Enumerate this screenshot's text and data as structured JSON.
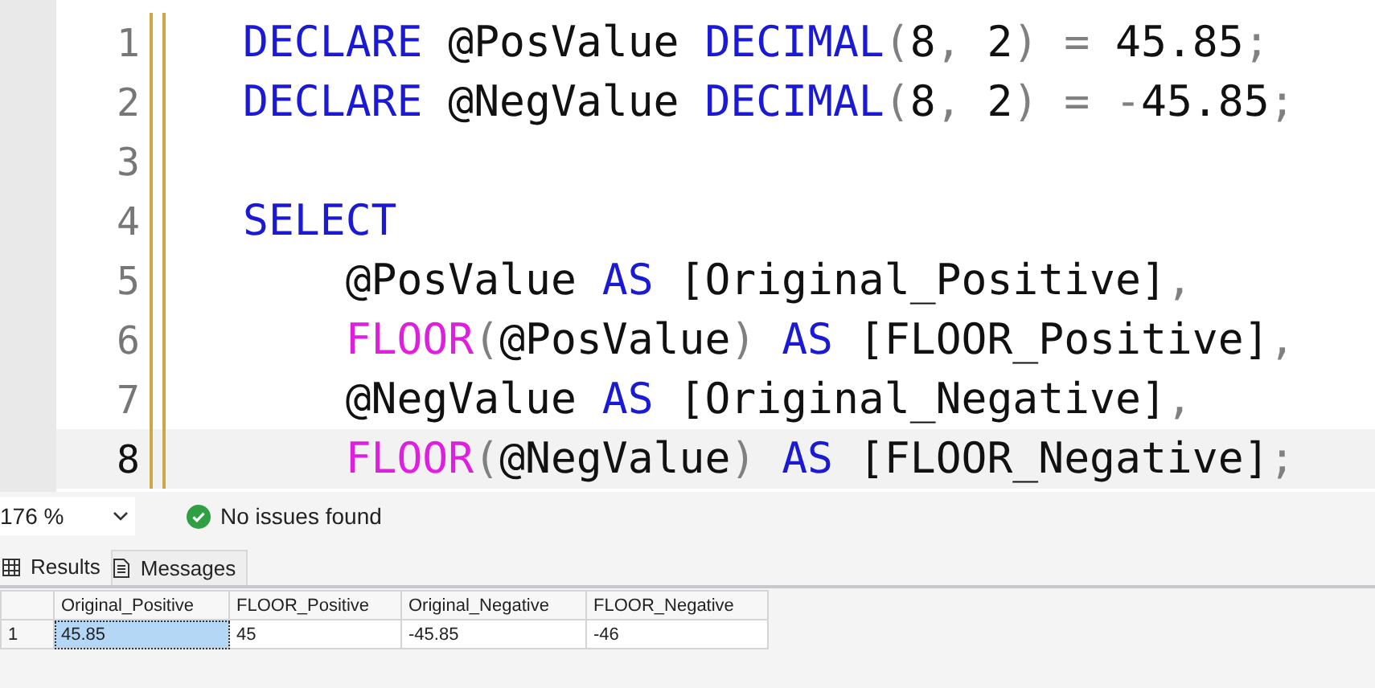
{
  "editor": {
    "lines": [
      {
        "number": "1",
        "current": false,
        "indent": false,
        "tokens": [
          {
            "kind": "keyword",
            "text": "DECLARE"
          },
          {
            "kind": "plain",
            "text": " @PosValue "
          },
          {
            "kind": "keyword",
            "text": "DECIMAL"
          },
          {
            "kind": "operator",
            "text": "("
          },
          {
            "kind": "plain",
            "text": "8"
          },
          {
            "kind": "operator",
            "text": ", "
          },
          {
            "kind": "plain",
            "text": "2"
          },
          {
            "kind": "operator",
            "text": ")"
          },
          {
            "kind": "operator",
            "text": " = "
          },
          {
            "kind": "plain",
            "text": "45.85"
          },
          {
            "kind": "operator",
            "text": ";"
          }
        ]
      },
      {
        "number": "2",
        "current": false,
        "indent": false,
        "tokens": [
          {
            "kind": "keyword",
            "text": "DECLARE"
          },
          {
            "kind": "plain",
            "text": " @NegValue "
          },
          {
            "kind": "keyword",
            "text": "DECIMAL"
          },
          {
            "kind": "operator",
            "text": "("
          },
          {
            "kind": "plain",
            "text": "8"
          },
          {
            "kind": "operator",
            "text": ", "
          },
          {
            "kind": "plain",
            "text": "2"
          },
          {
            "kind": "operator",
            "text": ")"
          },
          {
            "kind": "operator",
            "text": " = -"
          },
          {
            "kind": "plain",
            "text": "45.85"
          },
          {
            "kind": "operator",
            "text": ";"
          }
        ]
      },
      {
        "number": "3",
        "current": false,
        "indent": false
      },
      {
        "number": "4",
        "current": false,
        "indent": false,
        "tokens": [
          {
            "kind": "keyword",
            "text": "SELECT"
          }
        ]
      },
      {
        "number": "5",
        "current": false,
        "indent": true,
        "tokens": [
          {
            "kind": "plain",
            "text": "@PosValue "
          },
          {
            "kind": "keyword",
            "text": "AS"
          },
          {
            "kind": "plain",
            "text": " [Original_Positive]"
          },
          {
            "kind": "operator",
            "text": ","
          }
        ]
      },
      {
        "number": "6",
        "current": false,
        "indent": true,
        "tokens": [
          {
            "kind": "function",
            "text": "FLOOR"
          },
          {
            "kind": "operator",
            "text": "("
          },
          {
            "kind": "plain",
            "text": "@PosValue"
          },
          {
            "kind": "operator",
            "text": ")"
          },
          {
            "kind": "keyword",
            "text": " AS"
          },
          {
            "kind": "plain",
            "text": " [FLOOR_Positive]"
          },
          {
            "kind": "operator",
            "text": ","
          }
        ]
      },
      {
        "number": "7",
        "current": false,
        "indent": true,
        "tokens": [
          {
            "kind": "plain",
            "text": "@NegValue "
          },
          {
            "kind": "keyword",
            "text": "AS"
          },
          {
            "kind": "plain",
            "text": " [Original_Negative]"
          },
          {
            "kind": "operator",
            "text": ","
          }
        ]
      },
      {
        "number": "8",
        "current": true,
        "indent": true,
        "tokens": [
          {
            "kind": "function",
            "text": "FLOOR"
          },
          {
            "kind": "operator",
            "text": "("
          },
          {
            "kind": "plain",
            "text": "@NegValue"
          },
          {
            "kind": "operator",
            "text": ")"
          },
          {
            "kind": "keyword",
            "text": " AS"
          },
          {
            "kind": "plain",
            "text": " [FLOOR_Negative]"
          },
          {
            "kind": "operator",
            "text": ";"
          }
        ]
      }
    ]
  },
  "status": {
    "zoom": "176 %",
    "message": "No issues found"
  },
  "tabs": [
    {
      "label": "Results",
      "selected": true
    },
    {
      "label": "Messages",
      "selected": false
    }
  ],
  "grid": {
    "columns": [
      "Original_Positive",
      "FLOOR_Positive",
      "Original_Negative",
      "FLOOR_Negative"
    ],
    "rows": [
      {
        "number": "1",
        "cells": [
          {
            "text": "45.85",
            "selected": true
          },
          {
            "text": "45",
            "selected": false
          },
          {
            "text": "-45.85",
            "selected": false
          },
          {
            "text": "-46",
            "selected": false
          }
        ]
      }
    ]
  }
}
